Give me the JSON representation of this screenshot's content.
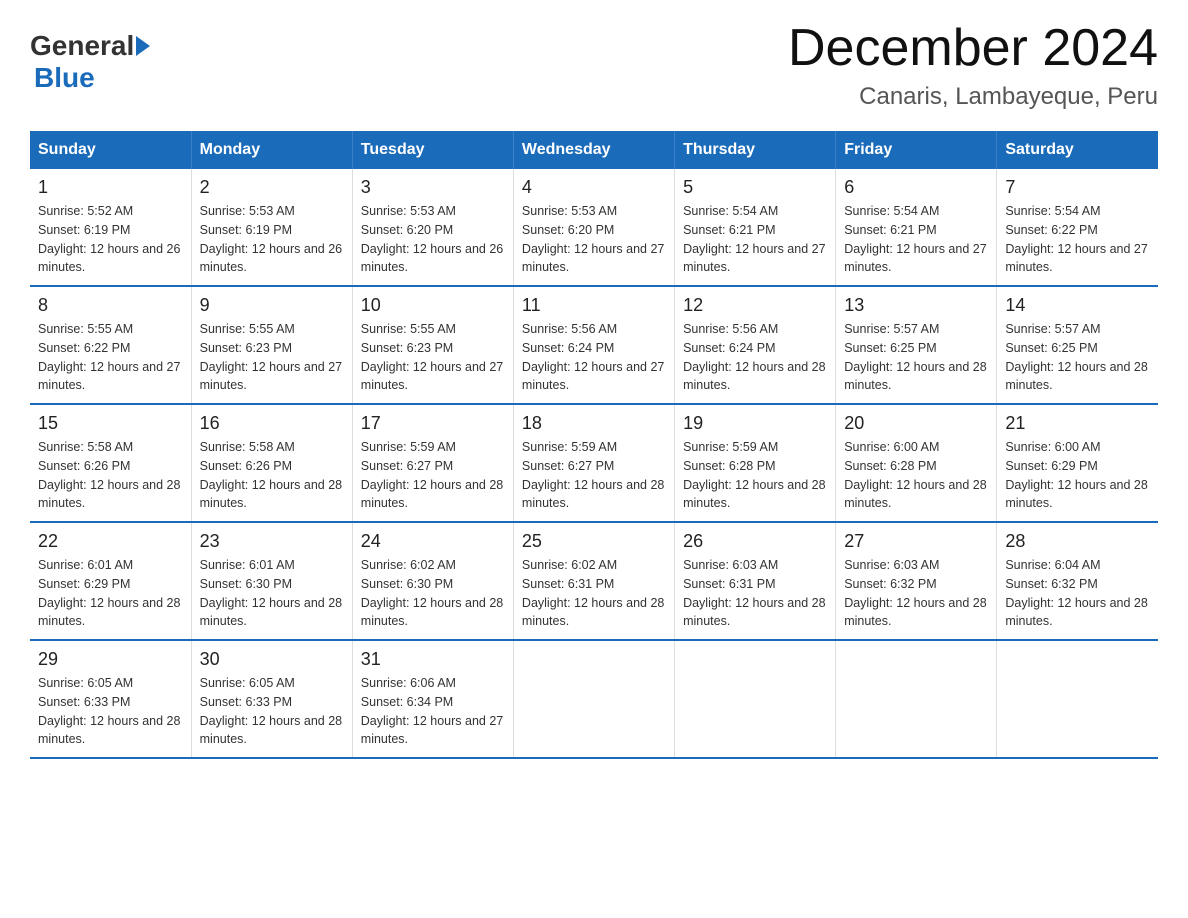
{
  "header": {
    "logo_general": "General",
    "logo_blue": "Blue",
    "main_title": "December 2024",
    "sub_title": "Canaris, Lambayeque, Peru"
  },
  "days_of_week": [
    "Sunday",
    "Monday",
    "Tuesday",
    "Wednesday",
    "Thursday",
    "Friday",
    "Saturday"
  ],
  "weeks": [
    [
      {
        "day": "1",
        "sunrise": "5:52 AM",
        "sunset": "6:19 PM",
        "daylight": "12 hours and 26 minutes."
      },
      {
        "day": "2",
        "sunrise": "5:53 AM",
        "sunset": "6:19 PM",
        "daylight": "12 hours and 26 minutes."
      },
      {
        "day": "3",
        "sunrise": "5:53 AM",
        "sunset": "6:20 PM",
        "daylight": "12 hours and 26 minutes."
      },
      {
        "day": "4",
        "sunrise": "5:53 AM",
        "sunset": "6:20 PM",
        "daylight": "12 hours and 27 minutes."
      },
      {
        "day": "5",
        "sunrise": "5:54 AM",
        "sunset": "6:21 PM",
        "daylight": "12 hours and 27 minutes."
      },
      {
        "day": "6",
        "sunrise": "5:54 AM",
        "sunset": "6:21 PM",
        "daylight": "12 hours and 27 minutes."
      },
      {
        "day": "7",
        "sunrise": "5:54 AM",
        "sunset": "6:22 PM",
        "daylight": "12 hours and 27 minutes."
      }
    ],
    [
      {
        "day": "8",
        "sunrise": "5:55 AM",
        "sunset": "6:22 PM",
        "daylight": "12 hours and 27 minutes."
      },
      {
        "day": "9",
        "sunrise": "5:55 AM",
        "sunset": "6:23 PM",
        "daylight": "12 hours and 27 minutes."
      },
      {
        "day": "10",
        "sunrise": "5:55 AM",
        "sunset": "6:23 PM",
        "daylight": "12 hours and 27 minutes."
      },
      {
        "day": "11",
        "sunrise": "5:56 AM",
        "sunset": "6:24 PM",
        "daylight": "12 hours and 27 minutes."
      },
      {
        "day": "12",
        "sunrise": "5:56 AM",
        "sunset": "6:24 PM",
        "daylight": "12 hours and 28 minutes."
      },
      {
        "day": "13",
        "sunrise": "5:57 AM",
        "sunset": "6:25 PM",
        "daylight": "12 hours and 28 minutes."
      },
      {
        "day": "14",
        "sunrise": "5:57 AM",
        "sunset": "6:25 PM",
        "daylight": "12 hours and 28 minutes."
      }
    ],
    [
      {
        "day": "15",
        "sunrise": "5:58 AM",
        "sunset": "6:26 PM",
        "daylight": "12 hours and 28 minutes."
      },
      {
        "day": "16",
        "sunrise": "5:58 AM",
        "sunset": "6:26 PM",
        "daylight": "12 hours and 28 minutes."
      },
      {
        "day": "17",
        "sunrise": "5:59 AM",
        "sunset": "6:27 PM",
        "daylight": "12 hours and 28 minutes."
      },
      {
        "day": "18",
        "sunrise": "5:59 AM",
        "sunset": "6:27 PM",
        "daylight": "12 hours and 28 minutes."
      },
      {
        "day": "19",
        "sunrise": "5:59 AM",
        "sunset": "6:28 PM",
        "daylight": "12 hours and 28 minutes."
      },
      {
        "day": "20",
        "sunrise": "6:00 AM",
        "sunset": "6:28 PM",
        "daylight": "12 hours and 28 minutes."
      },
      {
        "day": "21",
        "sunrise": "6:00 AM",
        "sunset": "6:29 PM",
        "daylight": "12 hours and 28 minutes."
      }
    ],
    [
      {
        "day": "22",
        "sunrise": "6:01 AM",
        "sunset": "6:29 PM",
        "daylight": "12 hours and 28 minutes."
      },
      {
        "day": "23",
        "sunrise": "6:01 AM",
        "sunset": "6:30 PM",
        "daylight": "12 hours and 28 minutes."
      },
      {
        "day": "24",
        "sunrise": "6:02 AM",
        "sunset": "6:30 PM",
        "daylight": "12 hours and 28 minutes."
      },
      {
        "day": "25",
        "sunrise": "6:02 AM",
        "sunset": "6:31 PM",
        "daylight": "12 hours and 28 minutes."
      },
      {
        "day": "26",
        "sunrise": "6:03 AM",
        "sunset": "6:31 PM",
        "daylight": "12 hours and 28 minutes."
      },
      {
        "day": "27",
        "sunrise": "6:03 AM",
        "sunset": "6:32 PM",
        "daylight": "12 hours and 28 minutes."
      },
      {
        "day": "28",
        "sunrise": "6:04 AM",
        "sunset": "6:32 PM",
        "daylight": "12 hours and 28 minutes."
      }
    ],
    [
      {
        "day": "29",
        "sunrise": "6:05 AM",
        "sunset": "6:33 PM",
        "daylight": "12 hours and 28 minutes."
      },
      {
        "day": "30",
        "sunrise": "6:05 AM",
        "sunset": "6:33 PM",
        "daylight": "12 hours and 28 minutes."
      },
      {
        "day": "31",
        "sunrise": "6:06 AM",
        "sunset": "6:34 PM",
        "daylight": "12 hours and 27 minutes."
      },
      null,
      null,
      null,
      null
    ]
  ]
}
